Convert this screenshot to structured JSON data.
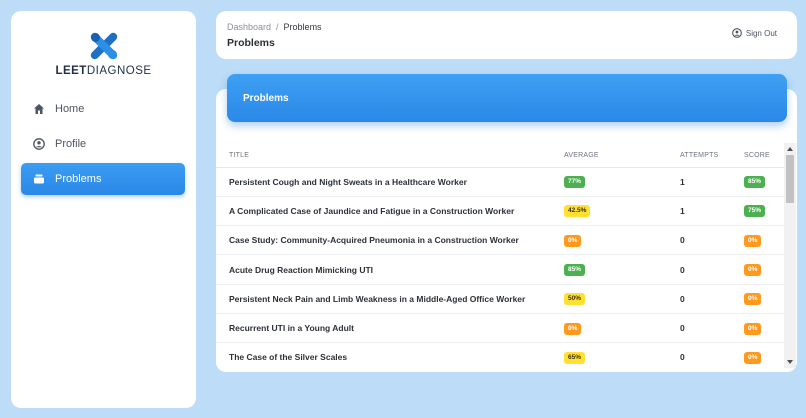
{
  "brand": {
    "name_bold": "LEET",
    "name_light": "DIAGNOSE"
  },
  "sidebar": {
    "items": [
      {
        "label": "Home",
        "icon": "home-icon"
      },
      {
        "label": "Profile",
        "icon": "user-circle-icon"
      },
      {
        "label": "Problems",
        "icon": "layers-icon",
        "active": true
      }
    ]
  },
  "header": {
    "breadcrumb_root": "Dashboard",
    "breadcrumb_sep": "/",
    "breadcrumb_current": "Problems",
    "title": "Problems",
    "signout_label": "Sign Out"
  },
  "card": {
    "title": "Problems"
  },
  "table": {
    "columns": [
      "TITLE",
      "AVERAGE",
      "ATTEMPTS",
      "SCORE"
    ],
    "rows": [
      {
        "title": "Persistent Cough and Night Sweats in a Healthcare Worker",
        "average": "77%",
        "average_color": "green",
        "attempts": "1",
        "score": "85%",
        "score_color": "green"
      },
      {
        "title": "A Complicated Case of Jaundice and Fatigue in a Construction Worker",
        "average": "42.5%",
        "average_color": "yellow",
        "attempts": "1",
        "score": "75%",
        "score_color": "green"
      },
      {
        "title": "Case Study: Community-Acquired Pneumonia in a Construction Worker",
        "average": "0%",
        "average_color": "orange",
        "attempts": "0",
        "score": "0%",
        "score_color": "orange"
      },
      {
        "title": "Acute Drug Reaction Mimicking UTI",
        "average": "85%",
        "average_color": "green",
        "attempts": "0",
        "score": "0%",
        "score_color": "orange"
      },
      {
        "title": "Persistent Neck Pain and Limb Weakness in a Middle-Aged Office Worker",
        "average": "50%",
        "average_color": "yellow",
        "attempts": "0",
        "score": "0%",
        "score_color": "orange"
      },
      {
        "title": "Recurrent UTI in a Young Adult",
        "average": "0%",
        "average_color": "orange",
        "attempts": "0",
        "score": "0%",
        "score_color": "orange"
      },
      {
        "title": "The Case of the Silver Scales",
        "average": "65%",
        "average_color": "yellow",
        "attempts": "0",
        "score": "0%",
        "score_color": "orange"
      }
    ]
  },
  "colors": {
    "accent": "#2b88e8",
    "background": "#bcdcf7",
    "green": "#4caf50",
    "yellow": "#ffe033",
    "orange": "#ff9a1f"
  }
}
